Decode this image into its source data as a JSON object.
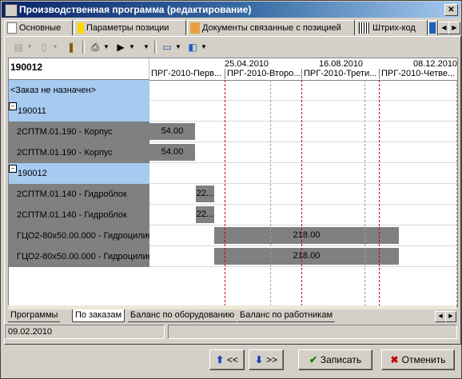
{
  "window": {
    "title": "Производственная программа (редактирование)",
    "close_glyph": "✕"
  },
  "tabs": [
    {
      "label": "Основные",
      "icon": "document-icon"
    },
    {
      "label": "Параметры позиции",
      "icon": "item-icon"
    },
    {
      "label": "Документы связанные с позицией",
      "icon": "documents-icon"
    },
    {
      "label": "Штрих-код",
      "icon": "barcode-icon"
    }
  ],
  "grid": {
    "header_title": "190012",
    "dates": [
      "25.04.2010",
      "16.08.2010",
      "08.12.2010"
    ],
    "periods": [
      "ПРГ-2010-Перв...",
      "ПРГ-2010-Второ...",
      "ПРГ-2010-Трети...",
      "ПРГ-2010-Четве..."
    ],
    "rows": [
      {
        "label": "<Заказ не назначен>",
        "kind": "group"
      },
      {
        "label": "190011",
        "kind": "group",
        "expander": "−"
      },
      {
        "label": "2СПТМ.01.190 - Корпус",
        "kind": "item",
        "bar_text": "54.00"
      },
      {
        "label": "2СПТМ.01.190 - Корпус",
        "kind": "item",
        "bar_text": "54.00"
      },
      {
        "label": "190012",
        "kind": "group",
        "expander": "−"
      },
      {
        "label": "2СПТМ.01.140 - Гидроблок",
        "kind": "item",
        "bar_text": "22..."
      },
      {
        "label": "2СПТМ.01.140 - Гидроблок",
        "kind": "item",
        "bar_text": "22..."
      },
      {
        "label": "ГЦО2-80x50.00.000 - Гидроцилин",
        "kind": "item",
        "bar_text": "218.00"
      },
      {
        "label": "ГЦО2-80x50.00.000 - Гидроцилин",
        "kind": "item",
        "bar_text": "218.00"
      }
    ]
  },
  "bottom_tabs": [
    "Программы",
    "По заказам",
    "Баланс по оборудованию",
    "Баланс по работникам"
  ],
  "status": {
    "date": "09.02.2010"
  },
  "buttons": {
    "prev": "<<",
    "next": ">>",
    "save": "Записать",
    "cancel": "Отменить"
  },
  "colors": {
    "titlebar": "#0a246a",
    "bar": "#808080",
    "group_row": "#a6caf0",
    "period_line": "#cc0000"
  }
}
